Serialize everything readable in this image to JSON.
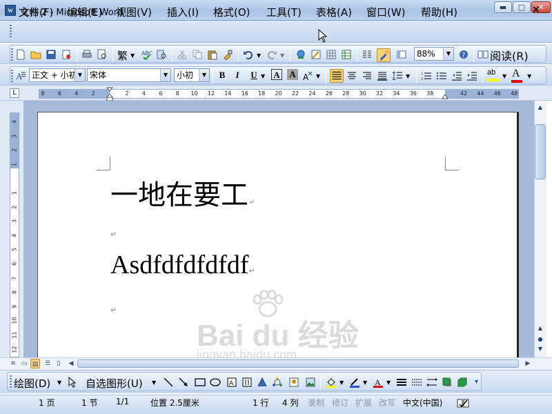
{
  "window": {
    "title": "文档 2 - Microsoft Word",
    "app_icon_text": "W",
    "minimize_symbol": "▬",
    "maximize_symbol": "□",
    "close_symbol": "✕"
  },
  "menubar": {
    "items": [
      {
        "label": "文件(F)"
      },
      {
        "label": "编辑(E)"
      },
      {
        "label": "视图(V)"
      },
      {
        "label": "插入(I)"
      },
      {
        "label": "格式(O)"
      },
      {
        "label": "工具(T)"
      },
      {
        "label": "表格(A)"
      },
      {
        "label": "窗口(W)"
      },
      {
        "label": "帮助(H)"
      }
    ],
    "doc_close_symbol": "×"
  },
  "standard_toolbar": {
    "zoom_value": "88%",
    "read_button_label": "阅读(R)",
    "traditional_char": "繁",
    "icons": [
      "new-icon",
      "open-icon",
      "save-icon",
      "permission-icon",
      "print-icon",
      "print-preview-icon",
      "spelling-icon",
      "research-icon",
      "cut-icon",
      "copy-icon",
      "paste-icon",
      "format-painter-icon",
      "undo-icon",
      "redo-icon",
      "hyperlink-icon",
      "tables-borders-icon",
      "insert-table-icon",
      "insert-excel-icon",
      "columns-icon",
      "drawing-icon",
      "document-map-icon",
      "help-icon"
    ]
  },
  "formatting_toolbar": {
    "style_value": "正文 + 小初",
    "font_value": "宋体",
    "size_value": "小初",
    "bold_label": "B",
    "italic_label": "I",
    "underline_label": "U",
    "char_border_label": "A",
    "char_shading_label": "A",
    "highlight_label": "ab",
    "font_color_label": "A",
    "highlight_color": "#ffff00",
    "font_color": "#e00000"
  },
  "ruler": {
    "ticks": [
      "8",
      "6",
      "4",
      "2",
      "",
      "2",
      "4",
      "6",
      "8",
      "10",
      "12",
      "14",
      "16",
      "18",
      "20",
      "22",
      "24",
      "26",
      "28",
      "30",
      "32",
      "34",
      "36",
      "38",
      "",
      "42",
      "44",
      "46",
      "48"
    ],
    "vertical_ticks": [
      "4",
      "3",
      "2",
      "1",
      "",
      "1",
      "2",
      "3",
      "4",
      "5",
      "6",
      "7",
      "8",
      "9",
      "10",
      "11",
      "12",
      "13",
      "14"
    ]
  },
  "document": {
    "heading_text": "一地在要工",
    "body_text": "Asdfdfdfdfdf",
    "paragraph_mark": "↵"
  },
  "drawing_toolbar": {
    "draw_label": "绘图(D)",
    "autoshapes_label": "自选图形(U)"
  },
  "statusbar": {
    "page": "1 页",
    "section": "1 节",
    "page_of": "1/1",
    "position": "位置 2.5厘米",
    "line": "1 行",
    "column": "4 列",
    "rec": "录制",
    "trk": "修订",
    "ext": "扩展",
    "ovr": "改写",
    "language": "中文(中国)"
  },
  "watermark": {
    "logo_text": "Bai du 经验",
    "url_text": "jingyan.baidu.com"
  },
  "colors": {
    "accent": "#2b5797",
    "page_background": "#a7b9d8"
  }
}
